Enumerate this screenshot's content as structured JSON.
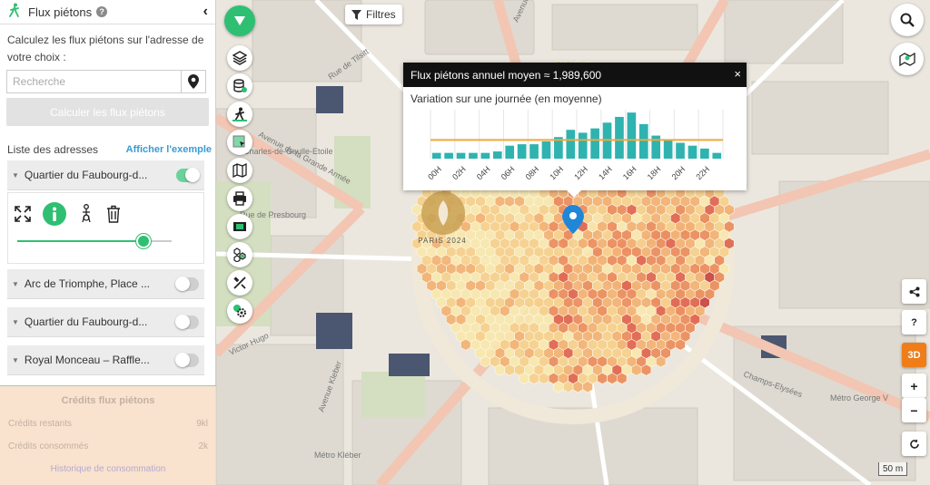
{
  "sidebar": {
    "title": "Flux piétons",
    "help": "?",
    "collapse": "‹",
    "intro": "Calculez les flux piétons sur l'adresse de votre choix :",
    "search_placeholder": "Recherche",
    "calc_button": "Calculer les flux piétons",
    "list_title": "Liste des adresses",
    "example_link": "Afficher l'exemple",
    "addresses": [
      {
        "label": "Quartier du Faubourg-d...",
        "on": true
      },
      {
        "label": "Arc de Triomphe, Place ...",
        "on": false
      },
      {
        "label": "Quartier du Faubourg-d...",
        "on": false
      },
      {
        "label": "Royal Monceau – Raffle...",
        "on": false
      }
    ],
    "slider_value": 0.82,
    "credits": {
      "title": "Crédits flux piétons",
      "rows": [
        {
          "label": "Crédits restants",
          "value": "9kl"
        },
        {
          "label": "Crédits consommés",
          "value": "2k"
        }
      ],
      "history": "Historique de consommation"
    }
  },
  "map": {
    "filter_button": "Filtres",
    "btn_3d": "3D",
    "help": "?",
    "zoom_in": "+",
    "zoom_out": "−",
    "scale": "50 m",
    "olympic_text": "PARIS 2024",
    "labels": [
      {
        "text": "Rue de Tilsitt"
      },
      {
        "text": "Avenue de la Grande Armée"
      },
      {
        "text": "Charles-de-Gaulle-Etoile"
      },
      {
        "text": "Avenue Kleber"
      },
      {
        "text": "Victor Hugo"
      },
      {
        "text": "Champs-Elysées"
      },
      {
        "text": "Métro George V"
      },
      {
        "text": "Avenue de Friedland"
      },
      {
        "text": "Rue de Presbourg"
      },
      {
        "text": "Métro Kléber"
      }
    ]
  },
  "popup": {
    "title": "Flux piétons annuel moyen ≈ 1,989,600",
    "close": "×",
    "subtitle": "Variation sur une journée (en moyenne)"
  },
  "chart_data": {
    "type": "bar",
    "title": "Variation sur une journée (en moyenne)",
    "categories": [
      "00H",
      "01H",
      "02H",
      "03H",
      "04H",
      "05H",
      "06H",
      "07H",
      "08H",
      "09H",
      "10H",
      "11H",
      "12H",
      "13H",
      "14H",
      "15H",
      "16H",
      "17H",
      "18H",
      "19H",
      "20H",
      "21H",
      "22H",
      "23H"
    ],
    "tick_labels": [
      "00H",
      "02H",
      "04H",
      "06H",
      "08H",
      "10H",
      "12H",
      "14H",
      "16H",
      "18H",
      "20H",
      "22H"
    ],
    "values": [
      4,
      4,
      4,
      4,
      4,
      5,
      9,
      10,
      10,
      12,
      15,
      20,
      18,
      21,
      25,
      29,
      32,
      24,
      16,
      13,
      11,
      9,
      7,
      4
    ],
    "average": 13,
    "ylim": [
      0,
      34
    ],
    "bar_color": "#2fb3b0",
    "average_color": "#f4a63a"
  }
}
